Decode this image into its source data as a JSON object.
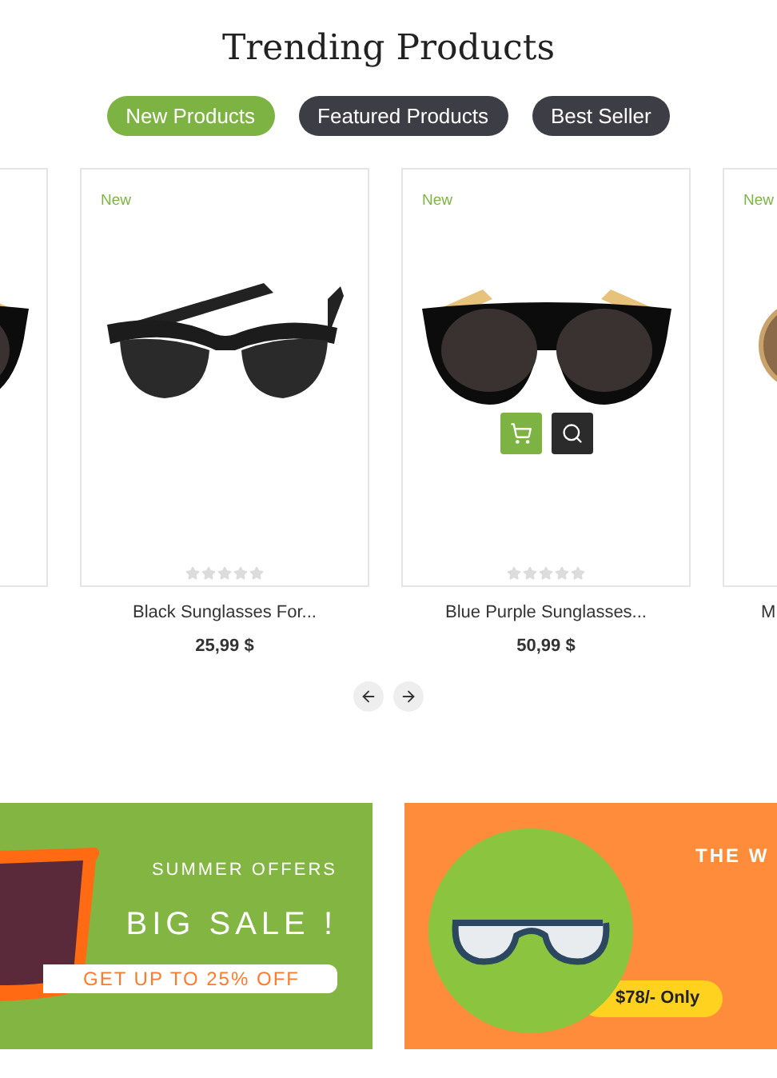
{
  "title": "Trending Products",
  "tabs": [
    {
      "label": "New Products",
      "selected": true
    },
    {
      "label": "Featured Products",
      "selected": false
    },
    {
      "label": "Best Seller",
      "selected": false
    }
  ],
  "products": [
    {
      "kind": "wayfarer"
    },
    {
      "kind": "clubmaster",
      "badge": "New",
      "stars": 0,
      "title": "Black Sunglasses For...",
      "price": "25,99 $",
      "show_actions": false
    },
    {
      "kind": "wayfarer",
      "badge": "New",
      "stars": 0,
      "title": "Blue Purple Sunglasses...",
      "price": "50,99 $",
      "show_actions": true
    },
    {
      "kind": "round",
      "badge": "New",
      "title": "M"
    }
  ],
  "banners": [
    {
      "kind": "sale",
      "eyebrow": "SUMMER OFFERS",
      "headline": "BIG SALE !",
      "pill": "GET UP TO 25% OFF"
    },
    {
      "kind": "price",
      "headline": "THE W",
      "pill": "$78/- Only"
    }
  ]
}
